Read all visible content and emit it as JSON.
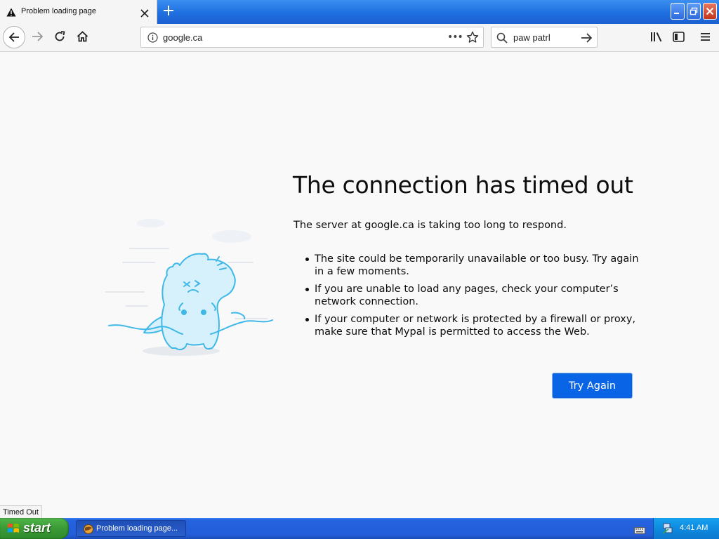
{
  "tab": {
    "title": "Problem loading page"
  },
  "navbar": {
    "url": "google.ca",
    "search_query": "paw patrl",
    "url_dots": "•••"
  },
  "error": {
    "title": "The connection has timed out",
    "description": "The server at google.ca is taking too long to respond.",
    "bullets": [
      "The site could be temporarily unavailable or too busy. Try again in a few moments.",
      "If you are unable to load any pages, check your computer’s network connection.",
      "If your computer or network is protected by a firewall or proxy, make sure that Mypal is permitted to access the Web."
    ],
    "try_again_label": "Try Again"
  },
  "status": {
    "text": "Timed Out"
  },
  "taskbar": {
    "start_label": "start",
    "task_label": "Problem loading page...",
    "clock": "4:41 AM"
  },
  "colors": {
    "accent_button": "#0a64e6",
    "titlebar_blue": "#1f6fe0",
    "start_green": "#3a9a35",
    "illustration_stroke": "#3fb8e8"
  }
}
